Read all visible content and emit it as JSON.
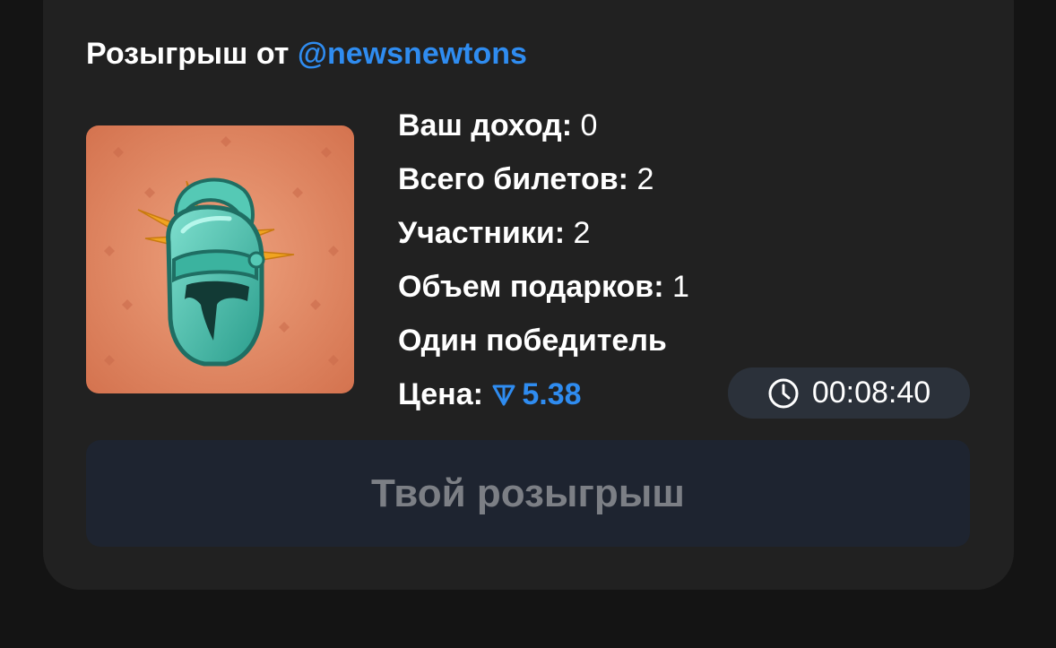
{
  "header": {
    "prefix": "Розыгрыш от",
    "handle": "@newsnewtons"
  },
  "gift": {
    "image_icon": "knight-helmet-icon",
    "background_color": "#d97d5c"
  },
  "stats": {
    "income_label": "Ваш доход:",
    "income_value": "0",
    "tickets_label": "Всего билетов:",
    "tickets_value": "2",
    "participants_label": "Участники:",
    "participants_value": "2",
    "gifts_label": "Объем подарков:",
    "gifts_value": "1",
    "winners_text": "Один победитель",
    "price_label": "Цена:",
    "price_value": "5.38",
    "price_icon": "ton-icon"
  },
  "timer": {
    "icon": "clock-icon",
    "value": "00:08:40"
  },
  "action": {
    "label": "Твой розыгрыш"
  },
  "colors": {
    "accent": "#2f8cf0",
    "card": "#212121",
    "page": "#141414",
    "button_bg": "#1e2430",
    "button_text": "#7c7f85"
  }
}
